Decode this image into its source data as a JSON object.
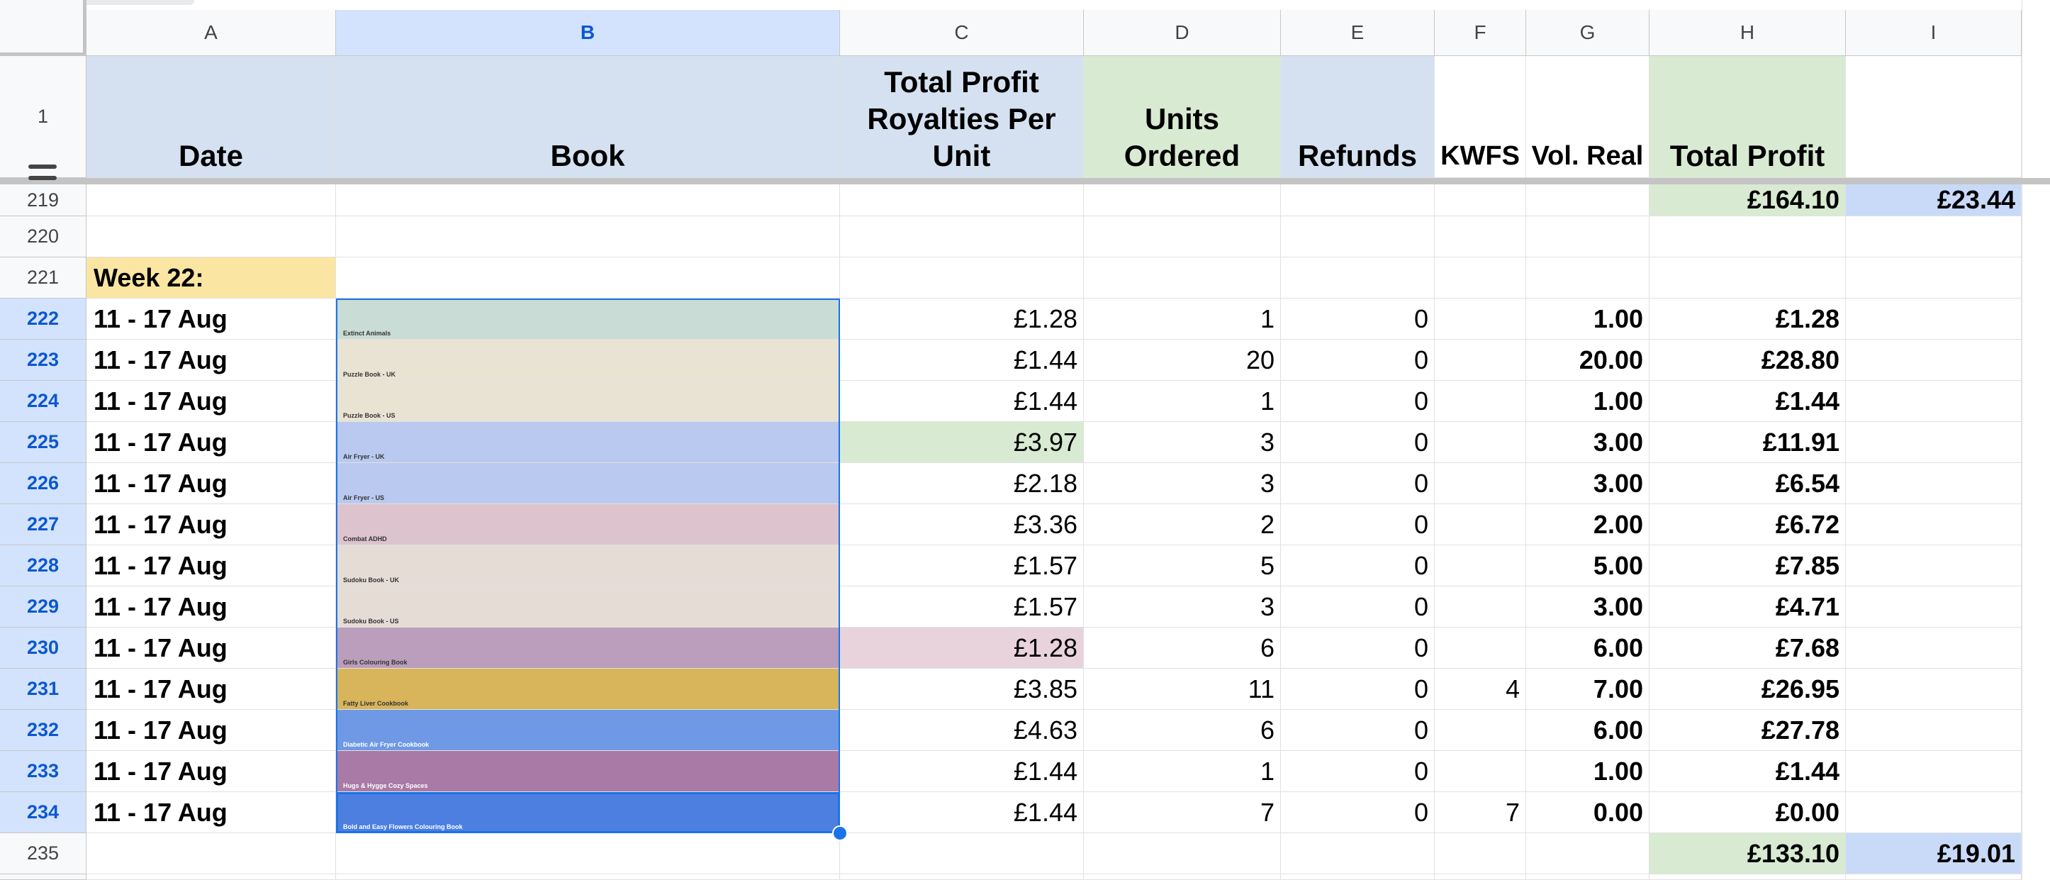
{
  "columns": [
    "A",
    "B",
    "C",
    "D",
    "E",
    "F",
    "G",
    "H",
    "I"
  ],
  "header_row": {
    "row_label": "1",
    "date": "Date",
    "book": "Book",
    "royalties": "Total Profit Royalties Per Unit",
    "units": "Units Ordered",
    "refunds": "Refunds",
    "kwfs": "KWFS",
    "vol_real": "Vol. Real",
    "total_profit": "Total Profit",
    "extra": ""
  },
  "totals_219": {
    "row_label": "219",
    "total_profit": "£164.10",
    "extra": "£23.44"
  },
  "row_220": {
    "row_label": "220"
  },
  "week_row": {
    "row_label": "221",
    "label": "Week 22:"
  },
  "data_rows": [
    {
      "row": "222",
      "date": "11 - 17 Aug",
      "book": "Extinct Animals",
      "book_color": "#c9dcd5",
      "book_text": "#333",
      "royalty": "£1.28",
      "units": "1",
      "refunds": "0",
      "kwfs": "",
      "vol": "1.00",
      "profit": "£1.28"
    },
    {
      "row": "223",
      "date": "11 - 17 Aug",
      "book": "Puzzle Book - UK",
      "book_color": "#e9e3d4",
      "book_text": "#333",
      "royalty": "£1.44",
      "units": "20",
      "refunds": "0",
      "kwfs": "",
      "vol": "20.00",
      "profit": "£28.80"
    },
    {
      "row": "224",
      "date": "11 - 17 Aug",
      "book": "Puzzle Book - US",
      "book_color": "#e9e3d4",
      "book_text": "#333",
      "royalty": "£1.44",
      "units": "1",
      "refunds": "0",
      "kwfs": "",
      "vol": "1.00",
      "profit": "£1.44"
    },
    {
      "row": "225",
      "date": "11 - 17 Aug",
      "book": "Air Fryer - UK",
      "book_color": "#b9c9f0",
      "book_text": "#333",
      "royalty": "£3.97",
      "royalty_bg": "#d9ead3",
      "units": "3",
      "refunds": "0",
      "kwfs": "",
      "vol": "3.00",
      "profit": "£11.91"
    },
    {
      "row": "226",
      "date": "11 - 17 Aug",
      "book": "Air Fryer - US",
      "book_color": "#b9c9f0",
      "book_text": "#333",
      "royalty": "£2.18",
      "units": "3",
      "refunds": "0",
      "kwfs": "",
      "vol": "3.00",
      "profit": "£6.54"
    },
    {
      "row": "227",
      "date": "11 - 17 Aug",
      "book": "Combat ADHD",
      "book_color": "#dcc3cd",
      "book_text": "#333",
      "royalty": "£3.36",
      "units": "2",
      "refunds": "0",
      "kwfs": "",
      "vol": "2.00",
      "profit": "£6.72"
    },
    {
      "row": "228",
      "date": "11 - 17 Aug",
      "book": "Sudoku Book - UK",
      "book_color": "#e6dcd6",
      "book_text": "#333",
      "royalty": "£1.57",
      "units": "5",
      "refunds": "0",
      "kwfs": "",
      "vol": "5.00",
      "profit": "£7.85"
    },
    {
      "row": "229",
      "date": "11 - 17 Aug",
      "book": "Sudoku Book - US",
      "book_color": "#e6dcd6",
      "book_text": "#333",
      "royalty": "£1.57",
      "units": "3",
      "refunds": "0",
      "kwfs": "",
      "vol": "3.00",
      "profit": "£4.71"
    },
    {
      "row": "230",
      "date": "11 - 17 Aug",
      "book": "Girls Colouring Book",
      "book_color": "#bb9ebb",
      "book_text": "#333",
      "royalty": "£1.28",
      "royalty_bg": "#e8d3dd",
      "units": "6",
      "refunds": "0",
      "kwfs": "",
      "vol": "6.00",
      "profit": "£7.68"
    },
    {
      "row": "231",
      "date": "11 - 17 Aug",
      "book": "Fatty Liver Cookbook",
      "book_color": "#d8b55a",
      "book_text": "#333",
      "royalty": "£3.85",
      "units": "11",
      "refunds": "0",
      "kwfs": "4",
      "vol": "7.00",
      "profit": "£26.95"
    },
    {
      "row": "232",
      "date": "11 - 17 Aug",
      "book": "Diabetic Air Fryer Cookbook",
      "book_color": "#6f99e4",
      "book_text": "#ffffff",
      "royalty": "£4.63",
      "units": "6",
      "refunds": "0",
      "kwfs": "",
      "vol": "6.00",
      "profit": "£27.78"
    },
    {
      "row": "233",
      "date": "11 - 17 Aug",
      "book": "Hugs & Hygge Cozy Spaces",
      "book_color": "#a97aa6",
      "book_text": "#ffffff",
      "royalty": "£1.44",
      "units": "1",
      "refunds": "0",
      "kwfs": "",
      "vol": "1.00",
      "profit": "£1.44"
    },
    {
      "row": "234",
      "date": "11 - 17 Aug",
      "book": "Bold and Easy Flowers Colouring Book",
      "book_color": "#4c7fe0",
      "book_text": "#ffffff",
      "royalty": "£1.44",
      "units": "7",
      "refunds": "0",
      "kwfs": "7",
      "vol": "0.00",
      "profit": "£0.00"
    }
  ],
  "totals_235": {
    "row_label": "235",
    "total_profit": "£133.10",
    "extra": "£19.01"
  },
  "colors": {
    "header_blue": "#d5e1f1",
    "header_green": "#d9ead3",
    "week_yellow": "#fbe5a3",
    "selection": "#1a73e8",
    "extra_blue": "#c9daf8"
  }
}
